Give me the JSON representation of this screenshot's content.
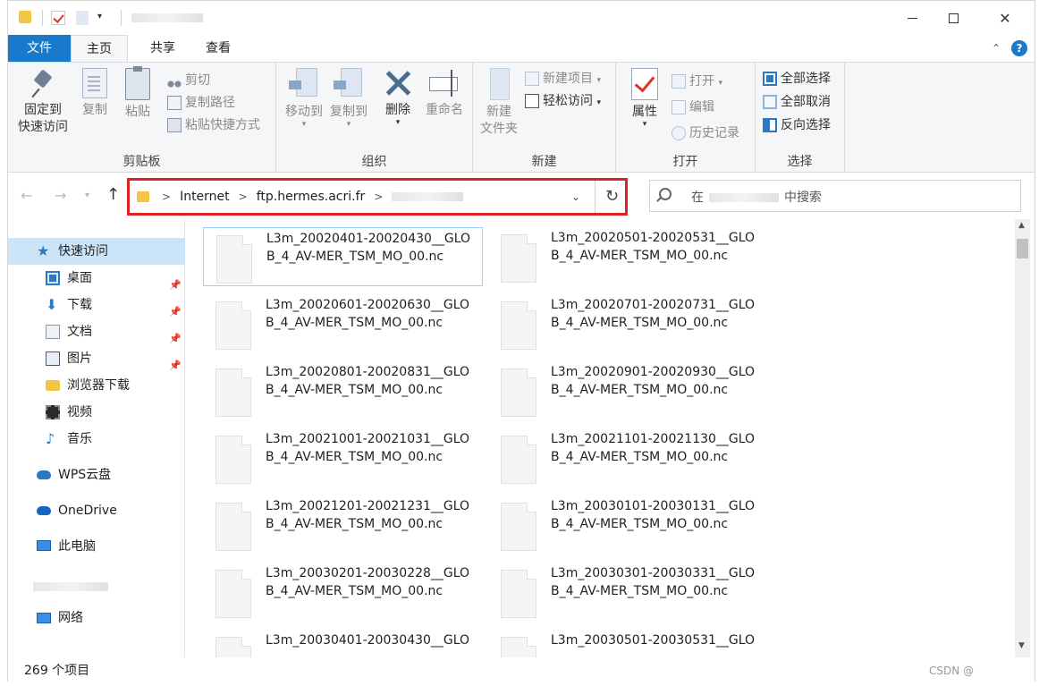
{
  "ribbon": {
    "tabs": [
      {
        "label": "文件"
      },
      {
        "label": "主页"
      },
      {
        "label": "共享"
      },
      {
        "label": "查看"
      }
    ],
    "clipboard": {
      "pin_label": "固定到\n快速访问",
      "pin_line1": "固定到",
      "pin_line2": "快速访问",
      "copy": "复制",
      "paste": "粘贴",
      "cut": "剪切",
      "copy_path": "复制路径",
      "paste_shortcut": "粘贴快捷方式",
      "group_label": "剪贴板"
    },
    "organize": {
      "move_to": "移动到",
      "copy_to": "复制到",
      "delete": "删除",
      "rename": "重命名",
      "group_label": "组织"
    },
    "new": {
      "new_folder_line1": "新建",
      "new_folder_line2": "文件夹",
      "new_item": "新建项目",
      "easy_access": "轻松访问",
      "group_label": "新建"
    },
    "open": {
      "properties": "属性",
      "open": "打开",
      "edit": "编辑",
      "history": "历史记录",
      "group_label": "打开"
    },
    "select": {
      "select_all": "全部选择",
      "select_none": "全部取消",
      "invert": "反向选择",
      "group_label": "选择"
    }
  },
  "address": {
    "crumbs": [
      "Internet",
      "ftp.hermes.acri.fr"
    ]
  },
  "search": {
    "prefix": "在",
    "suffix": "中搜索"
  },
  "nav": {
    "items": [
      {
        "label": "快速访问",
        "icon": "star-icon"
      },
      {
        "label": "桌面",
        "icon": "desktop-icon"
      },
      {
        "label": "下载",
        "icon": "download-icon"
      },
      {
        "label": "文档",
        "icon": "document-icon"
      },
      {
        "label": "图片",
        "icon": "pictures-icon"
      },
      {
        "label": "浏览器下载",
        "icon": "folder-icon"
      },
      {
        "label": "视频",
        "icon": "video-icon"
      },
      {
        "label": "音乐",
        "icon": "music-icon"
      },
      {
        "label": "WPS云盘",
        "icon": "cloud-icon"
      },
      {
        "label": "OneDrive",
        "icon": "onedrive-icon"
      },
      {
        "label": "此电脑",
        "icon": "computer-icon"
      },
      {
        "label": "网络",
        "icon": "network-icon"
      }
    ]
  },
  "files": [
    {
      "line1": "L3m_20020401-20020430__GLO",
      "line2": "B_4_AV-MER_TSM_MO_00.nc"
    },
    {
      "line1": "L3m_20020501-20020531__GLO",
      "line2": "B_4_AV-MER_TSM_MO_00.nc"
    },
    {
      "line1": "L3m_20020601-20020630__GLO",
      "line2": "B_4_AV-MER_TSM_MO_00.nc"
    },
    {
      "line1": "L3m_20020701-20020731__GLO",
      "line2": "B_4_AV-MER_TSM_MO_00.nc"
    },
    {
      "line1": "L3m_20020801-20020831__GLO",
      "line2": "B_4_AV-MER_TSM_MO_00.nc"
    },
    {
      "line1": "L3m_20020901-20020930__GLO",
      "line2": "B_4_AV-MER_TSM_MO_00.nc"
    },
    {
      "line1": "L3m_20021001-20021031__GLO",
      "line2": "B_4_AV-MER_TSM_MO_00.nc"
    },
    {
      "line1": "L3m_20021101-20021130__GLO",
      "line2": "B_4_AV-MER_TSM_MO_00.nc"
    },
    {
      "line1": "L3m_20021201-20021231__GLO",
      "line2": "B_4_AV-MER_TSM_MO_00.nc"
    },
    {
      "line1": "L3m_20030101-20030131__GLO",
      "line2": "B_4_AV-MER_TSM_MO_00.nc"
    },
    {
      "line1": "L3m_20030201-20030228__GLO",
      "line2": "B_4_AV-MER_TSM_MO_00.nc"
    },
    {
      "line1": "L3m_20030301-20030331__GLO",
      "line2": "B_4_AV-MER_TSM_MO_00.nc"
    },
    {
      "line1": "L3m_20030401-20030430__GLO",
      "line2": ""
    },
    {
      "line1": "L3m_20030501-20030531__GLO",
      "line2": ""
    }
  ],
  "status": {
    "count": "269 个项目",
    "watermark": "CSDN @"
  },
  "colors": {
    "accent": "#1979ca",
    "highlight_box": "#e1201f",
    "selection": "#cce4f7"
  }
}
